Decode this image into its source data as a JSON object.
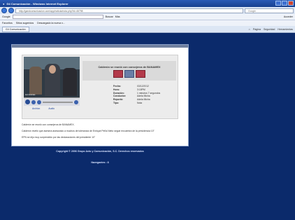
{
  "window": {
    "title": "G4 Comunicación - Windows Internet Explorer",
    "address": "http://gandcomunicacion.com/app/noticia/nota.php?id=46798",
    "search_engine": "Google"
  },
  "googlebar": {
    "label": "Google",
    "buttons": [
      "Buscar",
      "Más"
    ],
    "right": "Acceder"
  },
  "favorites": {
    "items": [
      "Favoritos",
      "Sitios sugeridos",
      "Descargado la nueva v..."
    ]
  },
  "tab": {
    "label": "G4 Comunicación"
  },
  "toolbar": {
    "items": [
      "Página",
      "Seguridad",
      "Herramientas"
    ]
  },
  "video": {
    "caption": "G4 Noticias"
  },
  "player_links": {
    "play": "Archivo",
    "download": "Audio"
  },
  "note": {
    "title": "Calderón se reunió con consejeros de BANAMEX",
    "details": [
      {
        "k": "Fecha:",
        "v": "03/12/2012"
      },
      {
        "k": "Hora:",
        "v": "3:18PM"
      },
      {
        "k": "Duración:",
        "v": "1 minutos 7 segundos"
      },
      {
        "k": "Conductor:",
        "v": "Adela Micha"
      },
      {
        "k": "Reportó:",
        "v": "Adela Micha"
      },
      {
        "k": "Tipo:",
        "v": "Nota"
      }
    ],
    "paragraphs": [
      "Calderón se reunió con consejeros de BANAMEX.",
      "Calderón reveló que asesiría asesorado a muchos de tolerancia de Enrique Peña Nieto seguir encuentra de la presidencia 10\"",
      "EPN se dijo muy sorprendido por las declaraciones del presidente 10\""
    ]
  },
  "footer": {
    "copyright": "Copyright © 2006 Grupo Acto y Comunicación, S.C. Derechos reservados",
    "counter": "Navegantes : 8"
  }
}
